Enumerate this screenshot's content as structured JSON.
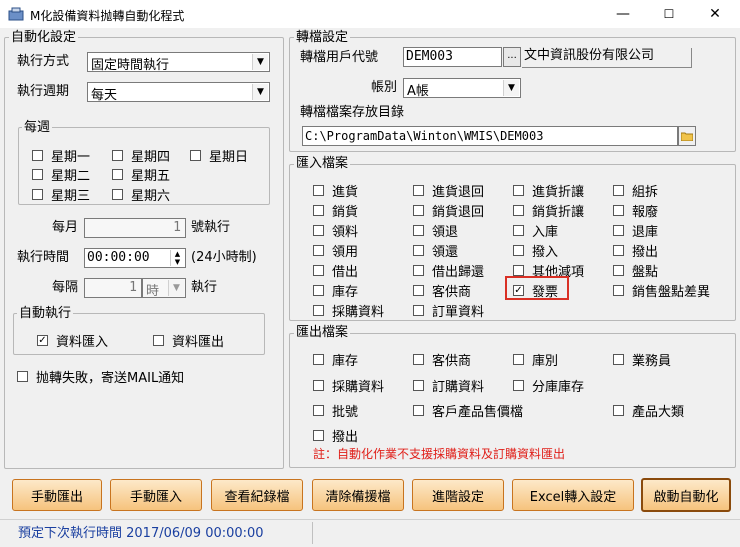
{
  "window": {
    "title": "M化設備資料抛轉自動化程式",
    "min": "—",
    "max": "☐",
    "close": "✕"
  },
  "auto": {
    "group_label": "自動化設定",
    "method_label": "執行方式",
    "method_value": "固定時間執行",
    "period_label": "執行週期",
    "period_value": "每天",
    "weekly_label": "每週",
    "weekdays": [
      "星期一",
      "星期四",
      "星期日",
      "星期二",
      "星期五",
      "星期三",
      "星期六"
    ],
    "monthly_label": "每月",
    "monthly_value": "1",
    "monthly_suffix": "號執行",
    "time_label": "執行時間",
    "time_value": "00:00:00",
    "time_suffix": "(24小時制)",
    "interval_label": "每隔",
    "interval_value": "1",
    "interval_unit": "時",
    "interval_suffix": "執行",
    "exec_group_label": "自動執行",
    "import_label": "資料匯入",
    "import_checked": "✓",
    "export_label": "資料匯出",
    "mail_label": "抛轉失敗，寄送MAIL通知"
  },
  "transfer": {
    "group_label": "轉檔設定",
    "user_label": "轉檔用戶代號",
    "user_value": "DEM003",
    "browse": "...",
    "company": "文中資訊股份有限公司",
    "book_label": "帳別",
    "book_value": "A帳",
    "path_label": "轉檔檔案存放目錄",
    "path_value": "C:\\ProgramData\\Winton\\WMIS\\DEM003"
  },
  "import": {
    "group_label": "匯入檔案",
    "items": [
      "進貨",
      "進貨退回",
      "進貨折讓",
      "組拆",
      "銷貨",
      "銷貨退回",
      "銷貨折讓",
      "報廢",
      "領料",
      "領退",
      "入庫",
      "退庫",
      "領用",
      "領還",
      "撥入",
      "撥出",
      "借出",
      "借出歸還",
      "其他減項",
      "盤點",
      "庫存",
      "客供商",
      "發票",
      "銷售盤點差異",
      "採購資料",
      "訂單資料"
    ],
    "invoice_checked": "✓"
  },
  "export": {
    "group_label": "匯出檔案",
    "items": [
      "庫存",
      "客供商",
      "庫別",
      "業務員",
      "採購資料",
      "訂購資料",
      "分庫庫存",
      "批號",
      "客戶產品售價檔",
      "產品大類",
      "撥出"
    ],
    "note": "註：自動化作業不支援採購資料及訂購資料匯出"
  },
  "buttons": [
    "手動匯出",
    "手動匯入",
    "查看紀錄檔",
    "清除備援檔",
    "進階設定",
    "Excel轉入設定",
    "啟動自動化"
  ],
  "status": {
    "text": "預定下次執行時間 2017/06/09 00:00:00"
  }
}
